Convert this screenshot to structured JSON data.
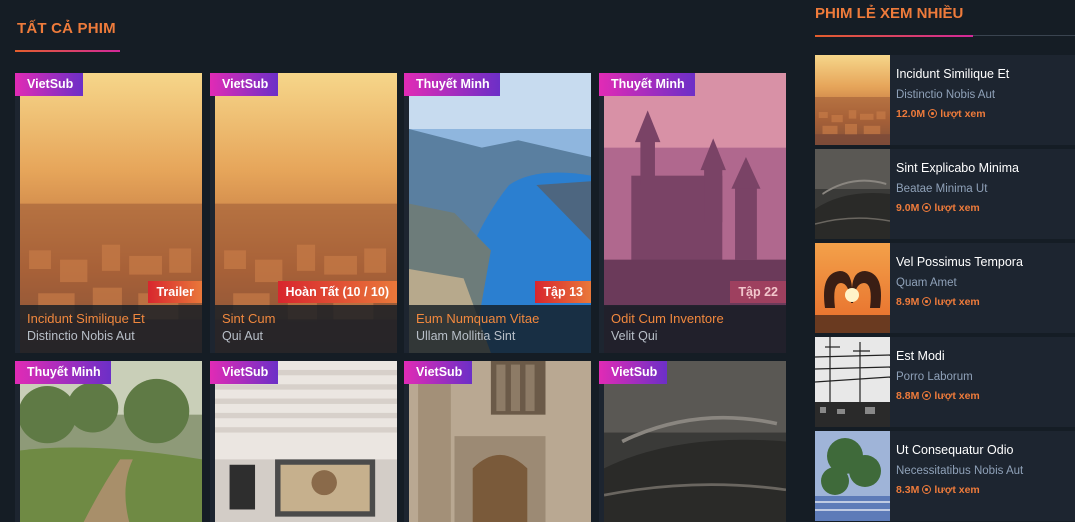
{
  "main": {
    "section_title": "TẤT CẢ PHIM",
    "cards": [
      {
        "lang": "VietSub",
        "status": "Trailer",
        "title": "Incidunt Similique Et",
        "sub": "Distinctio Nobis Aut",
        "poster": "city-sunset"
      },
      {
        "lang": "VietSub",
        "status": "Hoàn Tất (10 / 10)",
        "title": "Sint Cum",
        "sub": "Qui Aut",
        "poster": "city-sunset"
      },
      {
        "lang": "Thuyết Minh",
        "status": "Tập 13",
        "title": "Eum Numquam Vitae",
        "sub": "Ullam Mollitia Sint",
        "poster": "fjord"
      },
      {
        "lang": "Thuyết Minh",
        "status": "Tập 22",
        "title": "Odit Cum Inventore",
        "sub": "Velit Qui",
        "poster": "castle"
      },
      {
        "lang": "Thuyết Minh",
        "status": "",
        "title": "",
        "sub": "",
        "poster": "forest-path"
      },
      {
        "lang": "VietSub",
        "status": "",
        "title": "",
        "sub": "",
        "poster": "laptop-desk"
      },
      {
        "lang": "VietSub",
        "status": "",
        "title": "",
        "sub": "",
        "poster": "old-door"
      },
      {
        "lang": "VietSub",
        "status": "",
        "title": "",
        "sub": "",
        "poster": "car-bw"
      }
    ]
  },
  "sidebar": {
    "title": "PHIM LẺ XEM NHIỀU",
    "items": [
      {
        "title": "Incidunt Similique Et",
        "sub": "Distinctio Nobis Aut",
        "views": "12.0M",
        "views_label": "lượt xem",
        "thumb": "city-sunset"
      },
      {
        "title": "Sint Explicabo Minima",
        "sub": "Beatae Minima Ut",
        "views": "9.0M",
        "views_label": "lượt xem",
        "thumb": "car-bw"
      },
      {
        "title": "Vel Possimus Tempora",
        "sub": "Quam Amet",
        "views": "8.9M",
        "views_label": "lượt xem",
        "thumb": "heart-hands"
      },
      {
        "title": "Est Modi",
        "sub": "Porro Laborum",
        "views": "8.8M",
        "views_label": "lượt xem",
        "thumb": "power-lines"
      },
      {
        "title": "Ut Consequatur Odio",
        "sub": "Necessitatibus Nobis Aut",
        "views": "8.3M",
        "views_label": "lượt xem",
        "thumb": "tree-sky"
      }
    ]
  },
  "colors": {
    "accent": "#ee7b3b",
    "badge_pink": "#e12bb5",
    "badge_purple": "#6c2fc7",
    "bg": "#151d25"
  }
}
